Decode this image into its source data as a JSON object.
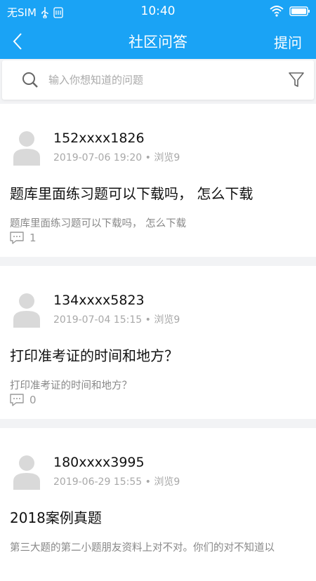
{
  "status_bar": {
    "carrier": "无SIM",
    "time": "10:40"
  },
  "nav": {
    "title": "社区问答",
    "ask_label": "提问"
  },
  "search": {
    "placeholder": "输入你想知道的问题"
  },
  "questions": [
    {
      "user": "152xxxx1826",
      "date": "2019-07-06 19:20",
      "views": "浏览9",
      "title": "题库里面练习题可以下载吗， 怎么下载",
      "body": "题库里面练习题可以下载吗， 怎么下载",
      "comments": "1"
    },
    {
      "user": "134xxxx5823",
      "date": "2019-07-04 15:15",
      "views": "浏览9",
      "title": "打印准考证的时间和地方？",
      "body": "打印准考证的时间和地方？",
      "comments": "0"
    },
    {
      "user": "180xxxx3995",
      "date": "2019-06-29 15:55",
      "views": "浏览9",
      "title": "2018案例真题",
      "body": "第三大题的第二小题朋友资料上对不对。你们的对不知道以"
    }
  ],
  "colors": {
    "primary": "#1aa3f5",
    "divider": "#f2f3f5"
  }
}
